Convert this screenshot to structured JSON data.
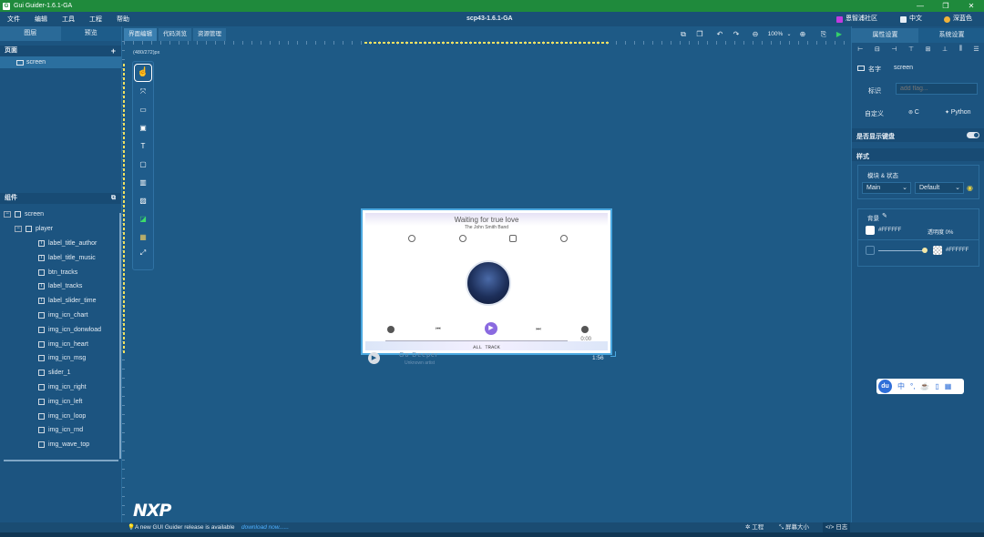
{
  "window": {
    "title": "Gui Guider-1.6.1-GA",
    "minimize": "—",
    "restore": "❐",
    "close": "✕"
  },
  "menu": {
    "items": [
      "文件",
      "编辑",
      "工具",
      "工程",
      "帮助"
    ],
    "project": "scp43-1.6.1-GA",
    "community": "恩智浦社区",
    "language": "中文",
    "theme": "深蓝色"
  },
  "left": {
    "tabs": [
      "图层",
      "预览"
    ],
    "pages_label": "页面",
    "page_item": "screen",
    "widgets_label": "组件",
    "tree": [
      {
        "label": "screen",
        "level": 0
      },
      {
        "label": "player",
        "level": 1
      },
      {
        "label": "label_title_author",
        "level": 2
      },
      {
        "label": "label_title_music",
        "level": 2
      },
      {
        "label": "btn_tracks",
        "level": 2
      },
      {
        "label": "label_tracks",
        "level": 2
      },
      {
        "label": "label_slider_time",
        "level": 2
      },
      {
        "label": "img_icn_chart",
        "level": 2
      },
      {
        "label": "img_icn_donwload",
        "level": 2
      },
      {
        "label": "img_icn_heart",
        "level": 2
      },
      {
        "label": "img_icn_msg",
        "level": 2
      },
      {
        "label": "slider_1",
        "level": 2
      },
      {
        "label": "img_icn_right",
        "level": 2
      },
      {
        "label": "img_icn_left",
        "level": 2
      },
      {
        "label": "img_icn_loop",
        "level": 2
      },
      {
        "label": "img_icn_rnd",
        "level": 2
      },
      {
        "label": "img_wave_top",
        "level": 2
      }
    ]
  },
  "canvas": {
    "tabs": [
      "界面编辑",
      "代码浏览",
      "资源管理"
    ],
    "resolution": "(480/272)px",
    "zoom": "100%",
    "preview": {
      "title": "Waiting for true love",
      "author": "The John Smith Band",
      "time": "0:00",
      "tracks": "ALL TRACK",
      "next_title": "Go Deeper",
      "next_artist": "Unknown artist",
      "next_time": "1:56"
    },
    "logo": "NXP"
  },
  "right": {
    "tabs": [
      "属性设置",
      "系统设置"
    ],
    "name_label": "名字",
    "name_value": "screen",
    "flag_label": "标识",
    "flag_placeholder": "add flag...",
    "custom_label": "自定义",
    "custom_c": "C",
    "custom_python": "Python",
    "keyboard_label": "是否显示键盘",
    "style_label": "样式",
    "part_state_label": "模块 & 状态",
    "part_value": "Main",
    "state_value": "Default",
    "bg_label": "背景",
    "bg_color": "#FFFFFF",
    "opacity_label": "透明度 0%",
    "grad_color": "#FFFFFF"
  },
  "ime": {
    "logo": "du",
    "mode": "中"
  },
  "status": {
    "notice": "A new GUI Guider release is available",
    "link": "download now......",
    "project": "工程",
    "screen_size": "屏幕大小",
    "log": "日志"
  }
}
